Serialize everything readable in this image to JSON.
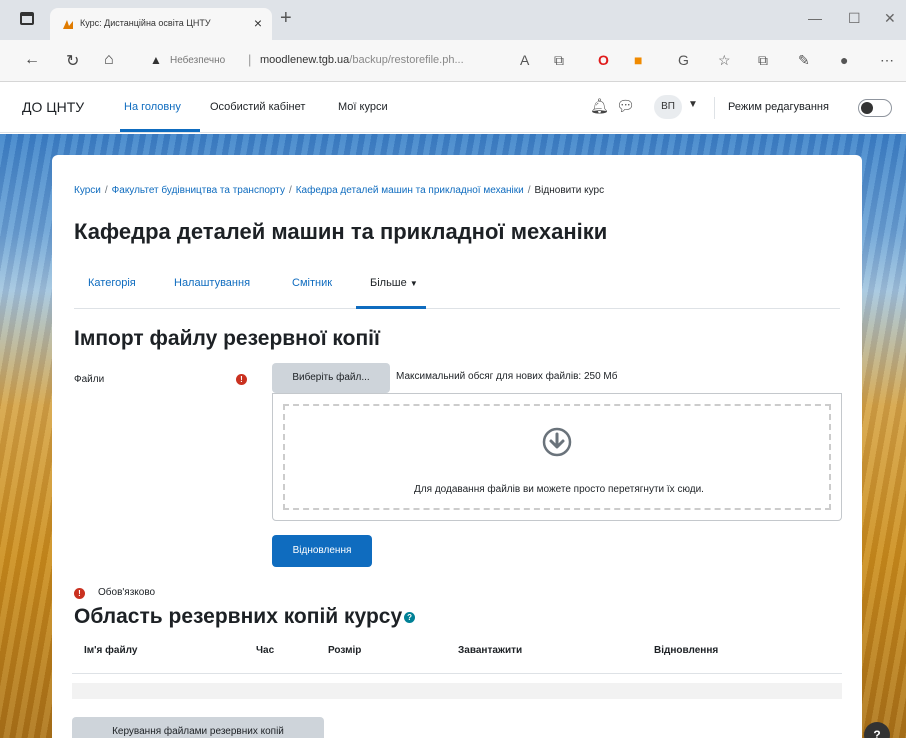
{
  "browser": {
    "tab_title": "Курс: Дистанційна освіта ЦНТУ",
    "new_tab_icon": "plus-icon",
    "address": {
      "security_label": "Небезпечно",
      "domain": "moodlenew.tgb.ua",
      "path": "/backup/restorefile.ph..."
    }
  },
  "navbar": {
    "brand": "ДО ЦНТУ",
    "links": [
      "На головну",
      "Особистий кабінет",
      "Мої курси"
    ],
    "avatar_initials": "ВП",
    "edit_mode_label": "Режим редагування"
  },
  "breadcrumb": [
    "Курси",
    "Факультет будівництва та транспорту",
    "Кафедра деталей машин та прикладної механіки",
    "Відновити курс"
  ],
  "page_title": "Кафедра деталей машин та прикладної механіки",
  "secondary_nav": [
    "Категорія",
    "Налаштування",
    "Смітник",
    "Більше"
  ],
  "import": {
    "heading": "Імпорт файлу резервної копії",
    "files_label": "Файли",
    "choose_button": "Виберіть файл...",
    "max_size": "Максимальний обсяг для нових файлів: 250 Мб",
    "drop_hint": "Для додавання файлів ви можете просто перетягнути їх сюди.",
    "restore_button": "Відновлення",
    "required_note": "Обов'язково"
  },
  "backup_area": {
    "heading": "Область резервних копій курсу",
    "columns": [
      "Ім'я файлу",
      "Час",
      "Розмір",
      "Завантажити",
      "Відновлення"
    ],
    "manage_button": "Керування файлами резервних копій"
  },
  "colors": {
    "primary": "#0f6cbf",
    "required": "#ca3120",
    "help": "#008196"
  }
}
